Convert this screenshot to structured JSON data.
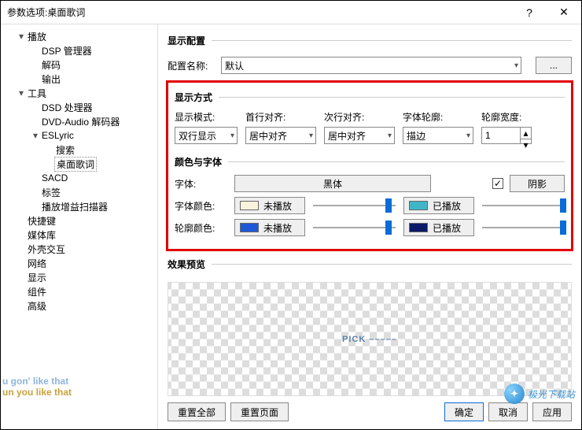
{
  "window": {
    "title": "参数选项:桌面歌词",
    "help": "?",
    "close": "✕"
  },
  "tree": [
    {
      "d": 0,
      "tw": "▾",
      "label": "播放"
    },
    {
      "d": 1,
      "tw": "",
      "label": "DSP 管理器"
    },
    {
      "d": 1,
      "tw": "",
      "label": "解码"
    },
    {
      "d": 1,
      "tw": "",
      "label": "输出"
    },
    {
      "d": 0,
      "tw": "▾",
      "label": "工具"
    },
    {
      "d": 1,
      "tw": "",
      "label": "DSD 处理器"
    },
    {
      "d": 1,
      "tw": "",
      "label": "DVD-Audio 解码器"
    },
    {
      "d": 1,
      "tw": "▾",
      "label": "ESLyric"
    },
    {
      "d": 2,
      "tw": "",
      "label": "搜索"
    },
    {
      "d": 2,
      "tw": "",
      "label": "桌面歌词",
      "selected": true
    },
    {
      "d": 1,
      "tw": "",
      "label": "SACD"
    },
    {
      "d": 1,
      "tw": "",
      "label": "标签"
    },
    {
      "d": 1,
      "tw": "",
      "label": "播放增益扫描器"
    },
    {
      "d": 0,
      "tw": "",
      "label": "快捷键"
    },
    {
      "d": 0,
      "tw": "",
      "label": "媒体库"
    },
    {
      "d": 0,
      "tw": "",
      "label": "外壳交互"
    },
    {
      "d": 0,
      "tw": "",
      "label": "网络"
    },
    {
      "d": 0,
      "tw": "",
      "label": "显示"
    },
    {
      "d": 0,
      "tw": "",
      "label": "组件"
    },
    {
      "d": 0,
      "tw": "",
      "label": "高级"
    }
  ],
  "sections": {
    "display_config": "显示配置",
    "display_mode": "显示方式",
    "color_font": "颜色与字体",
    "preview": "效果预览"
  },
  "config": {
    "name_label": "配置名称:",
    "name_value": "默认",
    "more": "..."
  },
  "mode": {
    "labels": {
      "mode": "显示模式:",
      "align1": "首行对齐:",
      "align2": "次行对齐:",
      "outline": "字体轮廓:",
      "outline_w": "轮廓宽度:"
    },
    "values": {
      "mode": "双行显示",
      "align1": "居中对齐",
      "align2": "居中对齐",
      "outline": "描边",
      "outline_w": "1"
    }
  },
  "font": {
    "font_label": "字体:",
    "font_value": "黑体",
    "shadow_label": "阴影",
    "shadow_checked": "✓",
    "text_color_label": "字体颜色:",
    "outline_color_label": "轮廓颜色:",
    "notplayed": "未播放",
    "played": "已播放",
    "swatches": {
      "tc_not": "#f9f3dc",
      "tc_play": "#3fb6c7",
      "oc_not": "#1e58d6",
      "oc_play": "#0a1a66"
    }
  },
  "preview_text": "PICK  –––––",
  "footer": {
    "reset_all": "重置全部",
    "reset_page": "重置页面",
    "ok": "确定",
    "cancel": "取消",
    "apply": "应用"
  },
  "ghost": {
    "l1": "u gon' like that",
    "l2": "un you like that"
  },
  "watermark": "极光下载站"
}
